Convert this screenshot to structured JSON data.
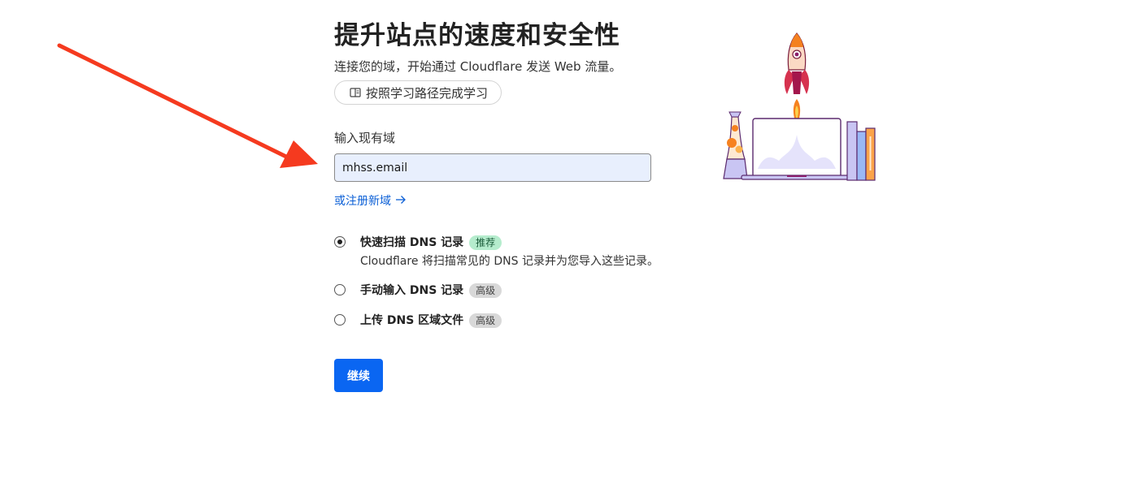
{
  "header": {
    "title": "提升站点的速度和安全性",
    "subtitle": "连接您的域，开始通过 Cloudflare 发送 Web 流量。",
    "learn_button": "按照学习路径完成学习"
  },
  "form": {
    "domain_label": "输入现有域",
    "domain_value": "mhss.email",
    "register_link": "或注册新域"
  },
  "options": [
    {
      "title": "快速扫描 DNS 记录",
      "badge": "推荐",
      "description": "Cloudflare 将扫描常见的 DNS 记录并为您导入这些记录。",
      "selected": true
    },
    {
      "title": "手动输入 DNS 记录",
      "badge": "高级",
      "selected": false
    },
    {
      "title": "上传 DNS 区域文件",
      "badge": "高级",
      "selected": false
    }
  ],
  "actions": {
    "continue_label": "继续"
  },
  "colors": {
    "primary": "#0a66f2",
    "link": "#0b5fd6",
    "annotation_arrow": "#f53a1f",
    "recommended_badge": "#b5eccd",
    "advanced_badge": "#d8d8d8"
  }
}
